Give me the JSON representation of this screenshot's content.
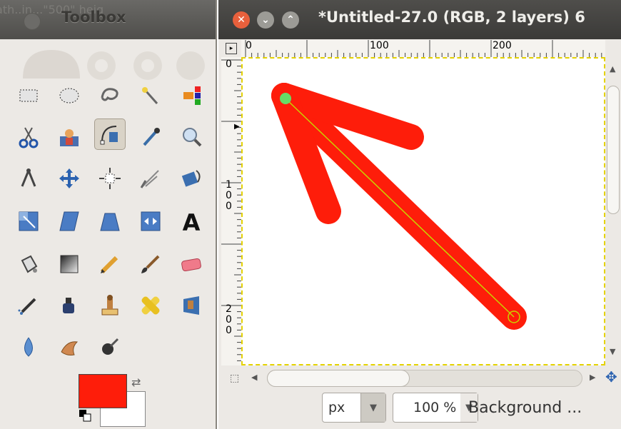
{
  "toolbox": {
    "title": "Toolbox",
    "ghost_text": "ath..in...\"500\" heig",
    "tools": [
      "rect-select-icon",
      "ellipse-select-icon",
      "free-select-icon",
      "fuzzy-select-icon",
      "color-select-icon",
      "scissors-select-icon",
      "foreground-select-icon",
      "paths-icon",
      "color-picker-icon",
      "zoom-icon",
      "measure-icon",
      "move-icon",
      "align-icon",
      "crop-icon",
      "rotate-icon",
      "scale-icon",
      "shear-icon",
      "perspective-icon",
      "flip-icon",
      "text-icon",
      "bucket-fill-icon",
      "blend-icon",
      "pencil-icon",
      "paintbrush-icon",
      "eraser-icon",
      "airbrush-icon",
      "ink-icon",
      "clone-icon",
      "heal-icon",
      "perspective-clone-icon",
      "blur-icon",
      "smudge-icon",
      "dodge-burn-icon"
    ],
    "active_tool": "paths-icon",
    "fg_color": "#fe1d0a",
    "bg_color": "#ffffff"
  },
  "image_window": {
    "title": "*Untitled-27.0 (RGB, 2 layers) 6",
    "ruler_h": [
      "0",
      "100",
      "200"
    ],
    "ruler_v": [
      "0",
      "1",
      "0",
      "0",
      "2",
      "0",
      "0"
    ],
    "stroke_color": "#fe1d0a",
    "path_color": "#c8d400",
    "anchor_color": "#66dd66"
  },
  "statusbar": {
    "unit": "px",
    "zoom": "100 %",
    "layer": "Background ..."
  }
}
